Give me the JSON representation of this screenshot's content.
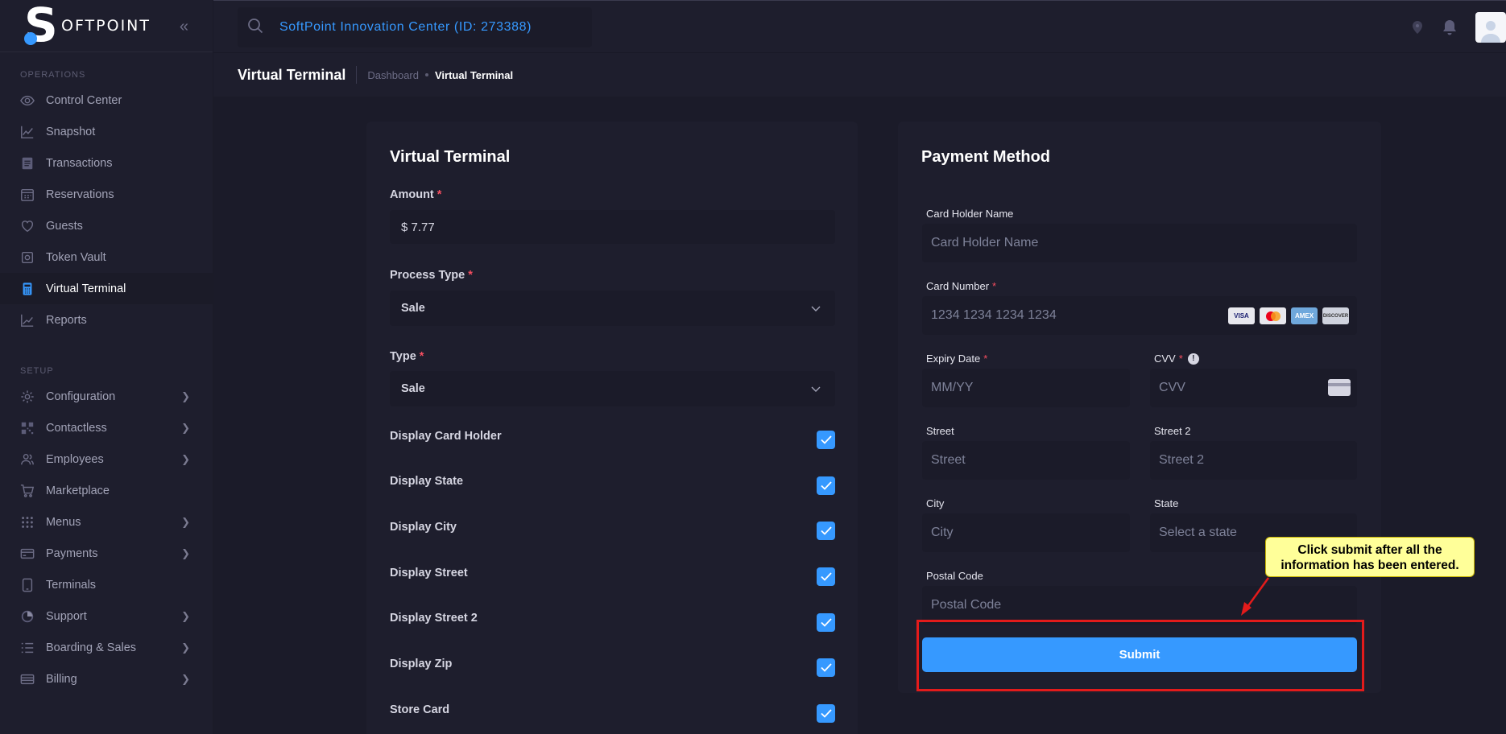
{
  "brand": {
    "logo_letter": "S",
    "logo_text": "OFTPOINT"
  },
  "sidebar": {
    "sections": [
      {
        "label": "OPERATIONS"
      },
      {
        "label": "SETUP"
      }
    ],
    "operations": [
      {
        "label": "Control Center",
        "icon": "eye-icon"
      },
      {
        "label": "Snapshot",
        "icon": "line-chart-icon"
      },
      {
        "label": "Transactions",
        "icon": "list-icon"
      },
      {
        "label": "Reservations",
        "icon": "calendar-icon"
      },
      {
        "label": "Guests",
        "icon": "heart-icon"
      },
      {
        "label": "Token Vault",
        "icon": "vault-icon"
      },
      {
        "label": "Virtual Terminal",
        "icon": "calculator-icon",
        "active": true
      },
      {
        "label": "Reports",
        "icon": "chart-icon"
      }
    ],
    "setup": [
      {
        "label": "Configuration",
        "icon": "gear-icon",
        "chevron": true
      },
      {
        "label": "Contactless",
        "icon": "qr-icon",
        "chevron": true
      },
      {
        "label": "Employees",
        "icon": "users-icon",
        "chevron": true
      },
      {
        "label": "Marketplace",
        "icon": "cart-icon",
        "chevron": false
      },
      {
        "label": "Menus",
        "icon": "grid-icon",
        "chevron": true
      },
      {
        "label": "Payments",
        "icon": "credit-card-icon",
        "chevron": true
      },
      {
        "label": "Terminals",
        "icon": "tablet-icon",
        "chevron": false
      },
      {
        "label": "Support",
        "icon": "support-icon",
        "chevron": true
      },
      {
        "label": "Boarding & Sales",
        "icon": "checklist-icon",
        "chevron": true
      },
      {
        "label": "Billing",
        "icon": "billing-icon",
        "chevron": true
      }
    ]
  },
  "header": {
    "location": "SoftPoint Innovation Center (ID: 273388)"
  },
  "subheader": {
    "title": "Virtual Terminal",
    "breadcrumb": [
      "Dashboard",
      "Virtual Terminal"
    ]
  },
  "terminal_card": {
    "title": "Virtual Terminal",
    "amount_label": "Amount",
    "amount_value": "$ 7.77",
    "process_type_label": "Process Type",
    "process_type_value": "Sale",
    "type_label": "Type",
    "type_value": "Sale",
    "required_mark": "*",
    "options": [
      {
        "label": "Display Card Holder",
        "checked": true
      },
      {
        "label": "Display State",
        "checked": true
      },
      {
        "label": "Display City",
        "checked": true
      },
      {
        "label": "Display Street",
        "checked": true
      },
      {
        "label": "Display Street 2",
        "checked": true
      },
      {
        "label": "Display Zip",
        "checked": true
      },
      {
        "label": "Store Card",
        "checked": true
      }
    ]
  },
  "payment_card": {
    "title": "Payment Method",
    "card_holder_label": "Card Holder Name",
    "card_holder_placeholder": "Card Holder Name",
    "card_number_label": "Card Number",
    "card_number_placeholder": "1234 1234 1234 1234",
    "card_brands": [
      "VISA",
      "MC",
      "AMEX",
      "DISCOVER"
    ],
    "expiry_label": "Expiry Date",
    "expiry_placeholder": "MM/YY",
    "cvv_label": "CVV",
    "cvv_placeholder": "CVV",
    "street_label": "Street",
    "street_placeholder": "Street",
    "street2_label": "Street 2",
    "street2_placeholder": "Street 2",
    "city_label": "City",
    "city_placeholder": "City",
    "state_label": "State",
    "state_placeholder": "Select a state",
    "postal_label": "Postal Code",
    "postal_placeholder": "Postal Code",
    "submit_label": "Submit"
  },
  "annotation": {
    "callout_text": "Click submit after all the information has been entered.",
    "highlight_color": "#e31b1b",
    "callout_bg": "#ffff99"
  },
  "colors": {
    "accent": "#3699ff",
    "sidebar_bg": "#1e1e2d",
    "page_bg": "#1b1b29",
    "required": "#f64e60"
  }
}
